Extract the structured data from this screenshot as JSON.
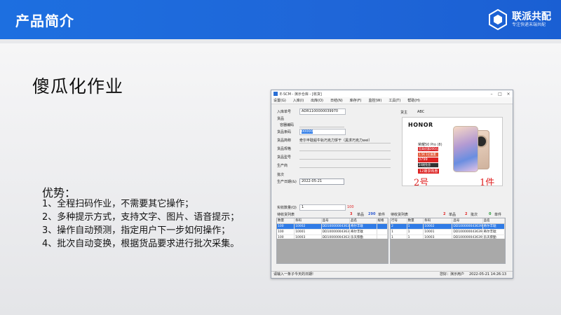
{
  "slide": {
    "banner_title": "产品简介",
    "brand_name": "联派共配",
    "brand_sub": "专注快递末端共配",
    "heading": "傻瓜化作业",
    "advantages_title": "优势：",
    "advantages": [
      "1、全程扫码作业，不需要其它操作；",
      "2、多种提示方式，支持文字、图片、语音提示；",
      "3、操作自动预测，指定用户下一步如何操作；",
      "4、批次自动变换，根据货品要求进行批次采集。"
    ]
  },
  "window": {
    "title": "E-SCM - 演示仓库 - [收货]",
    "controls": [
      "–",
      "□",
      "×"
    ],
    "menu": [
      "设置(G)",
      "入库(I)",
      "出库(O)",
      "日结(N)",
      "库存(F)",
      "监控(W)",
      "工具(T)",
      "帮助(H)"
    ],
    "form": {
      "inbound_no_label": "入库单号",
      "inbound_no": "ADR1100000039970",
      "goods_section": "货品",
      "container_label": "容器编码",
      "barcode_label": "货品条码",
      "barcode_value": "00000",
      "product_label": "货品简称",
      "product_value": "奇尔丰耽船牛轨巧克力饼干（黑求巧克力wei）",
      "spec_label": "货品规格",
      "model_label": "货品型号",
      "maker_label": "生产商",
      "batch_section": "批次",
      "prod_date_label": "生产日期(&)",
      "prod_date_value": "2022-05-21",
      "qty_label": "实收数量(Q)",
      "qty_value": "1",
      "qty_red": "100"
    },
    "owner_label": "货主",
    "owner_value": "ABC",
    "product_image": {
      "brand": "HONOR",
      "model": "荣耀50 Pro (8)",
      "promo1": "至高优惠200元",
      "promo2": "1.5K 1亿像素",
      "price": "3799",
      "promo3": "24期免息",
      "promo4": "12期享购惠",
      "label_left": "2号",
      "label_right": "1件"
    },
    "pending": {
      "caption": "待收货列表",
      "count": "3",
      "units_label": "单品",
      "units": "290",
      "pieces_label": "单件",
      "columns": [
        "数量",
        "条码",
        "品号",
        "品名",
        "规格"
      ],
      "rows": [
        [
          "100",
          "10002",
          "DD10000004363956",
          "奇尔丰耽",
          ""
        ],
        [
          "100",
          "10001",
          "DD10000004363966",
          "奇尔丰耽",
          ""
        ],
        [
          "100",
          "10003",
          "DD10000004363976",
          "乐天蔡勤",
          ""
        ]
      ]
    },
    "collected": {
      "caption": "待收货列表",
      "count": "2",
      "units_label": "单品",
      "batch_label": "批次",
      "batch": "2",
      "pieces_label": "单件",
      "pieces": "0",
      "columns": [
        "行号",
        "数量",
        "条码",
        "品号",
        "品名"
      ],
      "rows": [
        [
          "2",
          "1",
          "10002",
          "DD10000004363956",
          "奇尔丰耽"
        ],
        [
          "1",
          "1",
          "10001",
          "DD10000004363966",
          "奇尔丰耽"
        ],
        [
          "1",
          "1",
          "10003",
          "DD10000004363976",
          "乐天蔡勤"
        ]
      ]
    },
    "status": {
      "hint": "请输入一条子今天的日期!",
      "user": "您好：演示用户",
      "datetime": "2022-05-21 14:26:13"
    }
  },
  "colors": {
    "banner": "#1d6fe0",
    "accent_red": "#e02222",
    "select_blue": "#2f7be6"
  }
}
